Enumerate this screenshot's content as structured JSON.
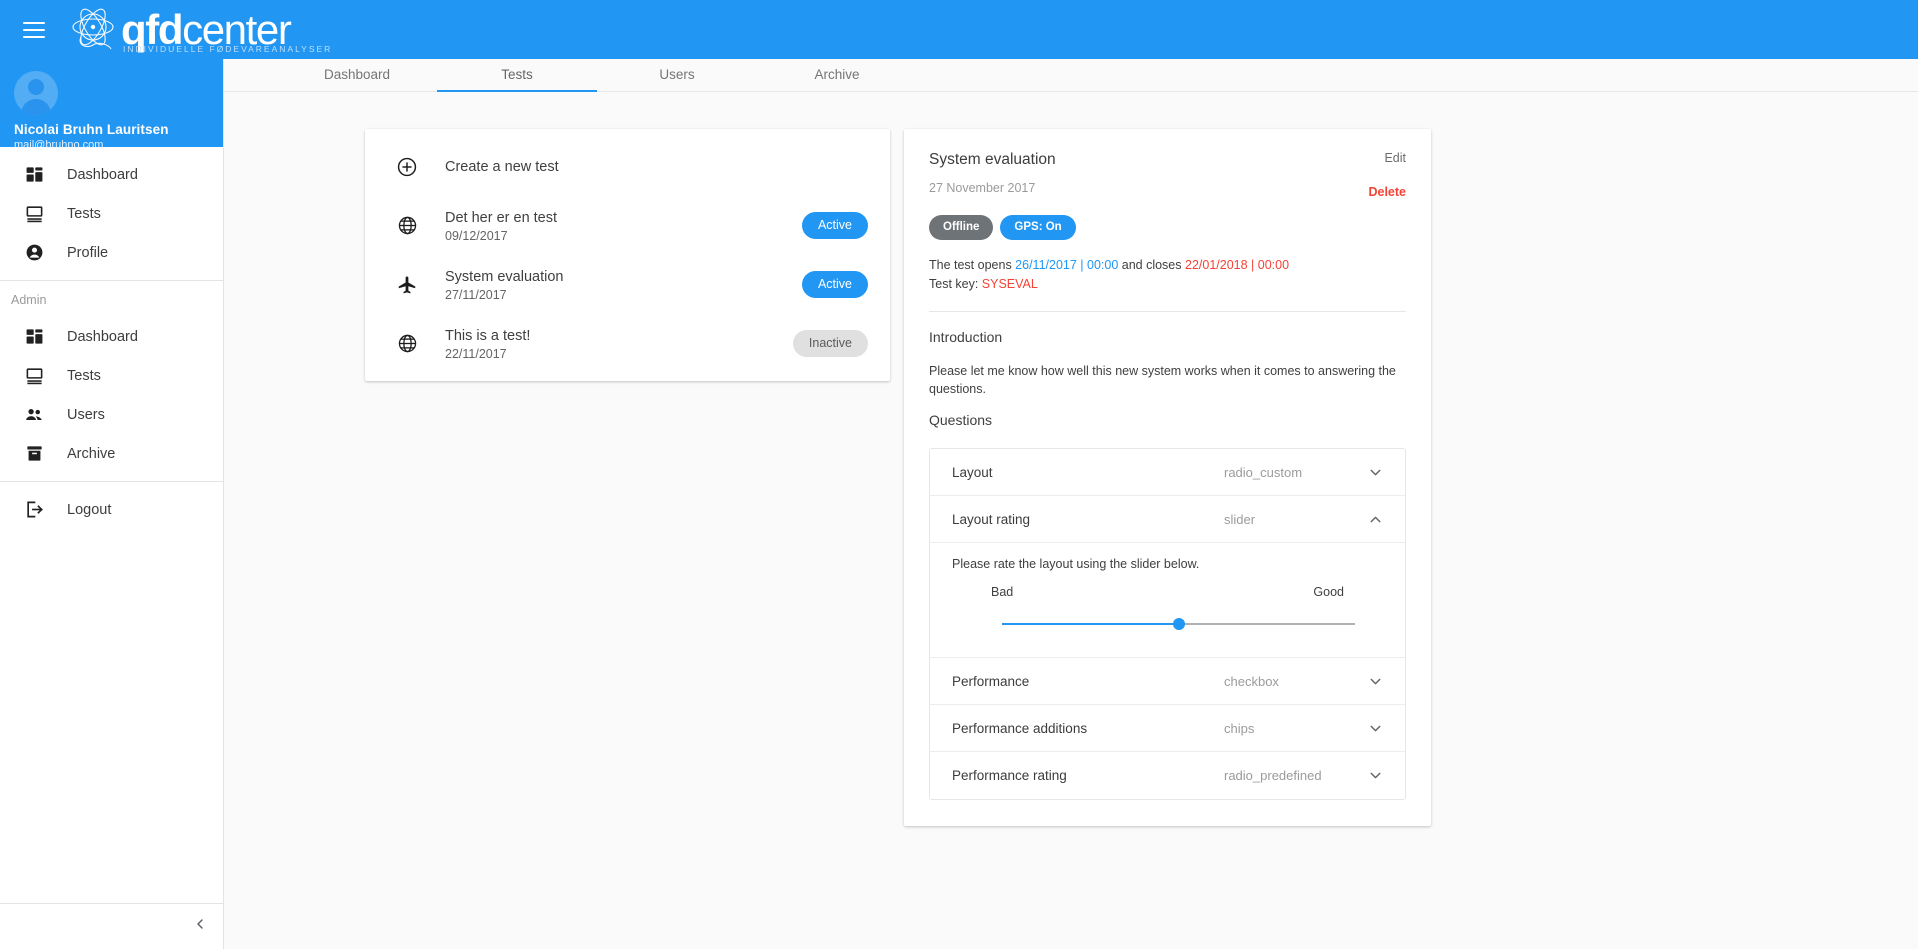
{
  "topbar": {
    "menu_icon": "hamburger-icon",
    "logo_bold": "qfd",
    "logo_light": "center",
    "logo_subtitle": "INDIVIDUELLE FØDEVAREANALYSER",
    "brand_color": "#2196f3"
  },
  "sidebar": {
    "profile": {
      "name": "Nicolai Bruhn Lauritsen",
      "email": "mail@bruhno.com",
      "avatar_icon": "avatar-icon"
    },
    "user_items": [
      {
        "label": "Dashboard",
        "icon": "dashboard-icon"
      },
      {
        "label": "Tests",
        "icon": "monitor-icon"
      },
      {
        "label": "Profile",
        "icon": "account-circle-icon"
      }
    ],
    "admin_section_label": "Admin",
    "admin_items": [
      {
        "label": "Dashboard",
        "icon": "dashboard-icon"
      },
      {
        "label": "Tests",
        "icon": "monitor-icon"
      },
      {
        "label": "Users",
        "icon": "people-icon"
      },
      {
        "label": "Archive",
        "icon": "archive-icon"
      }
    ],
    "logout": {
      "label": "Logout",
      "icon": "logout-icon"
    },
    "collapse_icon": "chevron-left-icon"
  },
  "tabs": [
    {
      "label": "Dashboard",
      "active": false
    },
    {
      "label": "Tests",
      "active": true
    },
    {
      "label": "Users",
      "active": false
    },
    {
      "label": "Archive",
      "active": false
    }
  ],
  "test_list": {
    "create_label": "Create a new test",
    "create_icon": "plus-circle-icon",
    "items": [
      {
        "title": "Det her er en test",
        "date": "09/12/2017",
        "icon": "globe-icon",
        "status": "Active",
        "status_type": "active"
      },
      {
        "title": "System evaluation",
        "date": "27/11/2017",
        "icon": "airplane-icon",
        "status": "Active",
        "status_type": "active"
      },
      {
        "title": "This is a test!",
        "date": "22/11/2017",
        "icon": "globe-icon",
        "status": "Inactive",
        "status_type": "inactive"
      }
    ]
  },
  "detail": {
    "title": "System evaluation",
    "date": "27 November 2017",
    "edit_label": "Edit",
    "delete_label": "Delete",
    "badges": [
      {
        "label": "Offline",
        "type": "grey"
      },
      {
        "label": "GPS: On",
        "type": "blue"
      }
    ],
    "schedule": {
      "prefix": "The test opens ",
      "open_date": "26/11/2017 | 00:00",
      "middle": " and closes ",
      "close_date": "22/01/2018 | 00:00"
    },
    "test_key_label": "Test key: ",
    "test_key_value": "SYSEVAL",
    "introduction_heading": "Introduction",
    "introduction_text": "Please let me know how well this new system works when it comes to answering the questions.",
    "questions_heading": "Questions",
    "questions": [
      {
        "name": "Layout",
        "type": "radio_custom",
        "expanded": false
      },
      {
        "name": "Layout rating",
        "type": "slider",
        "expanded": true,
        "prompt": "Please rate the layout using the slider below.",
        "slider": {
          "min_label": "Bad",
          "max_label": "Good",
          "value_percent": 50
        }
      },
      {
        "name": "Performance",
        "type": "checkbox",
        "expanded": false
      },
      {
        "name": "Performance additions",
        "type": "chips",
        "expanded": false
      },
      {
        "name": "Performance rating",
        "type": "radio_predefined",
        "expanded": false
      }
    ]
  },
  "colors": {
    "accent": "#2196f3",
    "danger": "#f44336",
    "grey_badge": "#6e7378",
    "inactive_chip": "#e0e0e0"
  }
}
